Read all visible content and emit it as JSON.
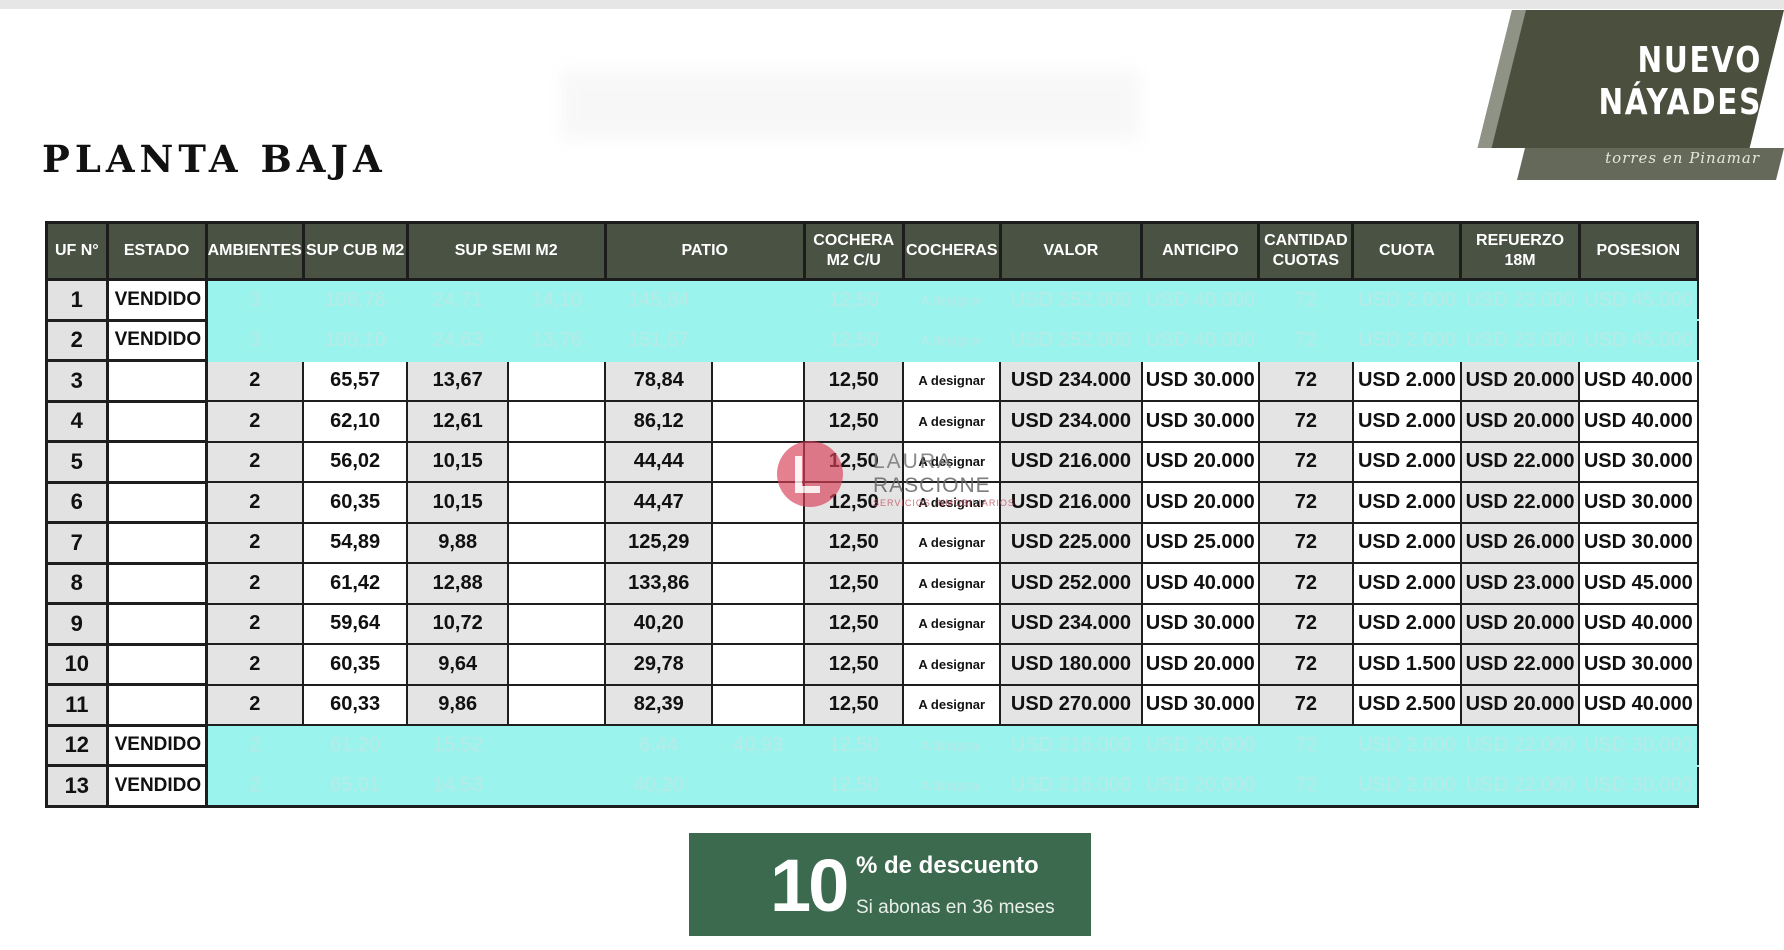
{
  "page_title": "PLANTA BAJA",
  "brand": {
    "name": "NUEVO\nNÁYADES",
    "tagline": "torres en Pinamar"
  },
  "watermark": {
    "line1": "LAURA",
    "line2": "RASCIONE",
    "line3": "SERVICIOS INMOBILIARIOS"
  },
  "table": {
    "headers": [
      "UF N°",
      "ESTADO",
      "AMBIENTES",
      "SUP CUB M2",
      "SUP SEMI M2",
      "PATIO",
      "COCHERA M2 C/U",
      "COCHERAS",
      "VALOR",
      "ANTICIPO",
      "CANTIDAD CUOTAS",
      "CUOTA",
      "REFUERZO 18M",
      "POSESION"
    ],
    "rows": [
      {
        "uf": "1",
        "estado": "VENDIDO",
        "cells": [
          "3",
          "108,78",
          "24,71",
          "14,10",
          "145,84",
          "",
          "12,50",
          "A designar",
          "USD 252.000",
          "USD 40.000",
          "72",
          "USD 2.000",
          "USD 23.000",
          "USD 45.000"
        ]
      },
      {
        "uf": "2",
        "estado": "VENDIDO",
        "cells": [
          "3",
          "109,10",
          "24,63",
          "13,76",
          "151,57",
          "",
          "12,50",
          "A designar",
          "USD 252.000",
          "USD 40.000",
          "72",
          "USD 2.000",
          "USD 23.000",
          "USD 45.000"
        ]
      },
      {
        "uf": "3",
        "estado": "",
        "cells": [
          "2",
          "65,57",
          "13,67",
          "",
          "78,84",
          "",
          "12,50",
          "A designar",
          "USD 234.000",
          "USD 30.000",
          "72",
          "USD 2.000",
          "USD 20.000",
          "USD 40.000"
        ]
      },
      {
        "uf": "4",
        "estado": "",
        "cells": [
          "2",
          "62,10",
          "12,61",
          "",
          "86,12",
          "",
          "12,50",
          "A designar",
          "USD 234.000",
          "USD 30.000",
          "72",
          "USD 2.000",
          "USD 20.000",
          "USD 40.000"
        ]
      },
      {
        "uf": "5",
        "estado": "",
        "cells": [
          "2",
          "56,02",
          "10,15",
          "",
          "44,44",
          "",
          "12,50",
          "A designar",
          "USD 216.000",
          "USD 20.000",
          "72",
          "USD 2.000",
          "USD 22.000",
          "USD 30.000"
        ]
      },
      {
        "uf": "6",
        "estado": "",
        "cells": [
          "2",
          "60,35",
          "10,15",
          "",
          "44,47",
          "",
          "12,50",
          "A designar",
          "USD 216.000",
          "USD 20.000",
          "72",
          "USD 2.000",
          "USD 22.000",
          "USD 30.000"
        ]
      },
      {
        "uf": "7",
        "estado": "",
        "cells": [
          "2",
          "54,89",
          "9,88",
          "",
          "125,29",
          "",
          "12,50",
          "A designar",
          "USD 225.000",
          "USD 25.000",
          "72",
          "USD 2.000",
          "USD 26.000",
          "USD 30.000"
        ]
      },
      {
        "uf": "8",
        "estado": "",
        "cells": [
          "2",
          "61,42",
          "12,88",
          "",
          "133,86",
          "",
          "12,50",
          "A designar",
          "USD 252.000",
          "USD 40.000",
          "72",
          "USD 2.000",
          "USD 23.000",
          "USD 45.000"
        ]
      },
      {
        "uf": "9",
        "estado": "",
        "cells": [
          "2",
          "59,64",
          "10,72",
          "",
          "40,20",
          "",
          "12,50",
          "A designar",
          "USD 234.000",
          "USD 30.000",
          "72",
          "USD 2.000",
          "USD 20.000",
          "USD 40.000"
        ]
      },
      {
        "uf": "10",
        "estado": "",
        "cells": [
          "2",
          "60,35",
          "9,64",
          "",
          "29,78",
          "",
          "12,50",
          "A designar",
          "USD 180.000",
          "USD 20.000",
          "72",
          "USD 1.500",
          "USD 22.000",
          "USD 30.000"
        ]
      },
      {
        "uf": "11",
        "estado": "",
        "cells": [
          "2",
          "60,33",
          "9,86",
          "",
          "82,39",
          "",
          "12,50",
          "A designar",
          "USD 270.000",
          "USD 30.000",
          "72",
          "USD 2.500",
          "USD 20.000",
          "USD 40.000"
        ]
      },
      {
        "uf": "12",
        "estado": "VENDIDO",
        "cells": [
          "2",
          "61,20",
          "15,52",
          "",
          "6,44",
          "40,93",
          "12,50",
          "A designar",
          "USD 216.000",
          "USD 20.000",
          "72",
          "USD 2.000",
          "USD 22.000",
          "USD 30.000"
        ]
      },
      {
        "uf": "13",
        "estado": "VENDIDO",
        "cells": [
          "2",
          "65,01",
          "14,53",
          "",
          "40,20",
          "",
          "12,50",
          "A designar",
          "USD 216.000",
          "USD 20.000",
          "72",
          "USD 2.000",
          "USD 22.000",
          "USD 30.000"
        ]
      }
    ]
  },
  "discount": {
    "number": "10",
    "label": "% de descuento",
    "sub": "Si abonas en 36 meses"
  },
  "colors": {
    "header_bg": "#4a5243",
    "sold_row": "#9af3ec",
    "brand_bg": "#4b4f3e",
    "discount_bg": "#3c6a4e"
  }
}
